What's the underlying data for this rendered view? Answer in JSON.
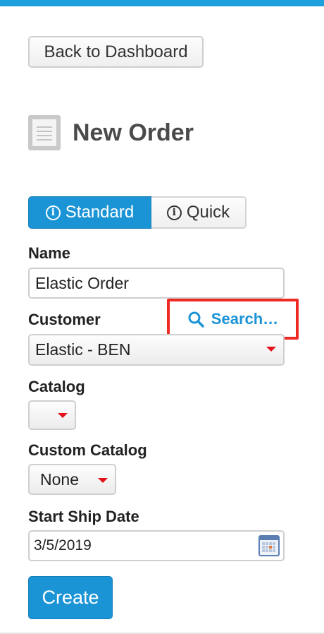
{
  "nav": {
    "back_label": "Back to Dashboard"
  },
  "page": {
    "title": "New Order",
    "icon": "document-icon"
  },
  "mode_toggle": {
    "standard_label": "Standard",
    "quick_label": "Quick",
    "selected": "Standard",
    "icon": "info-icon"
  },
  "form": {
    "name": {
      "label": "Name",
      "value": "Elastic Order"
    },
    "customer": {
      "label": "Customer",
      "search_label": "Search…",
      "selected": "Elastic - BEN"
    },
    "catalog": {
      "label": "Catalog",
      "selected": ""
    },
    "custom_catalog": {
      "label": "Custom Catalog",
      "selected": "None"
    },
    "start_ship_date": {
      "label": "Start Ship Date",
      "value": "3/5/2019"
    },
    "submit_label": "Create"
  },
  "colors": {
    "accent": "#1b94d6",
    "top_bar": "#1ea0dc",
    "caret": "#e4101a",
    "highlight_box": "#ee2a22"
  }
}
